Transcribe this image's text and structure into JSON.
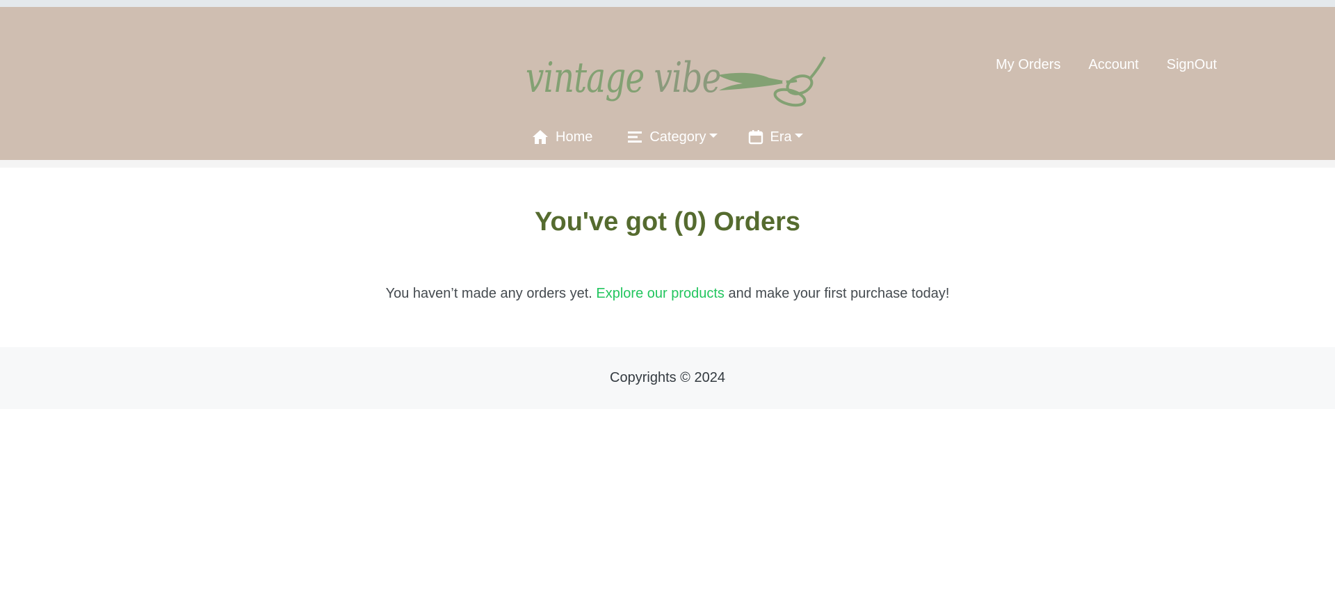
{
  "logo": {
    "text_part1": "vintage",
    "text_part2": "vibe",
    "icon": "scissors-icon"
  },
  "user_nav": {
    "my_orders": "My Orders",
    "account": "Account",
    "sign_out": "SignOut"
  },
  "main_nav": {
    "home": {
      "label": "Home",
      "icon": "home-icon"
    },
    "category": {
      "label": "Category",
      "icon": "menu-lines-icon"
    },
    "era": {
      "label": "Era",
      "icon": "calendar-icon"
    }
  },
  "page": {
    "title": "You've got (0) Orders",
    "message_before": "You haven’t made any orders yet. ",
    "message_link": "Explore our products",
    "message_after": " and make your first purchase today!"
  },
  "footer": {
    "copyright": "Copyrights © 2024"
  },
  "colors": {
    "header_bg": "#cfbeb1",
    "logo_green": "#83a173",
    "title_olive": "#556b2f",
    "link_green": "#22c55e",
    "footer_bg": "#f7f8f9"
  }
}
